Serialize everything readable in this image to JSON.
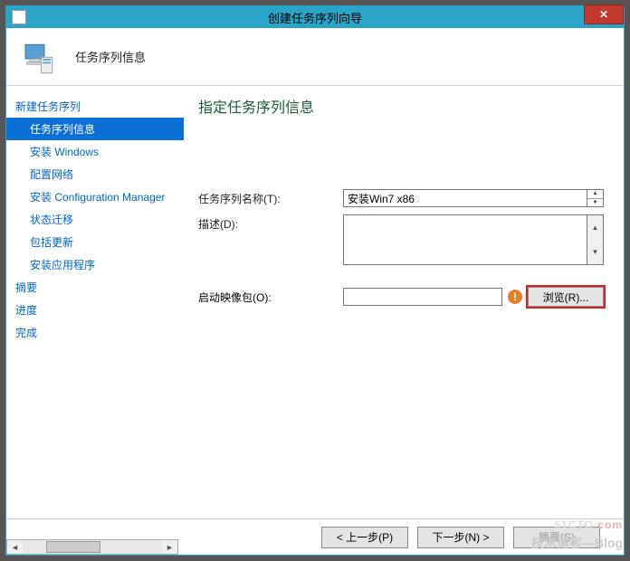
{
  "window": {
    "title": "创建任务序列向导",
    "close_glyph": "✕"
  },
  "header": {
    "subtitle": "任务序列信息"
  },
  "sidebar": {
    "top": "新建任务序列",
    "items": [
      {
        "label": "任务序列信息",
        "selected": true
      },
      {
        "label": "安装 Windows",
        "selected": false
      },
      {
        "label": "配置网络",
        "selected": false
      },
      {
        "label": "安装 Configuration Manager",
        "selected": false
      },
      {
        "label": "状态迁移",
        "selected": false
      },
      {
        "label": "包括更新",
        "selected": false
      },
      {
        "label": "安装应用程序",
        "selected": false
      }
    ],
    "plain": [
      {
        "label": "摘要"
      },
      {
        "label": "进度"
      },
      {
        "label": "完成"
      }
    ]
  },
  "main": {
    "page_title": "指定任务序列信息",
    "name_label": "任务序列名称(T):",
    "name_value": "安装Win7 x86",
    "desc_label": "描述(D):",
    "desc_value": "",
    "boot_label": "启动映像包(O):",
    "boot_value": "",
    "browse_label": "浏览(R)...",
    "warn_glyph": "!"
  },
  "footer": {
    "prev": "< 上一步(P)",
    "next": "下一步(N) >",
    "summary": "摘要(S)"
  },
  "watermark": {
    "line1a": "51CTO",
    "line1b": ".com",
    "line2": "技术博客—Blog"
  }
}
